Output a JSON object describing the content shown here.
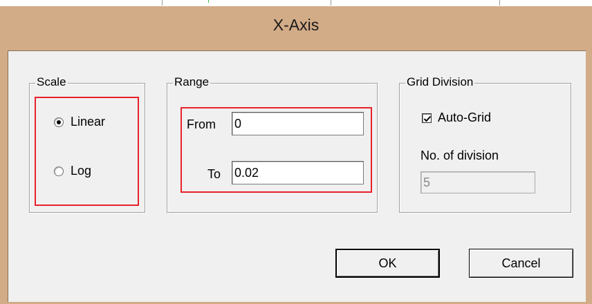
{
  "dialog": {
    "title": "X-Axis"
  },
  "scale": {
    "label": "Scale",
    "options": [
      {
        "label": "Linear",
        "selected": true
      },
      {
        "label": "Log",
        "selected": false
      }
    ]
  },
  "range": {
    "label": "Range",
    "from_label": "From",
    "from_value": "0",
    "to_label": "To",
    "to_value": "0.02"
  },
  "grid": {
    "label": "Grid Division",
    "auto_grid_label": "Auto-Grid",
    "auto_grid_checked": true,
    "division_label": "No. of division",
    "division_value": "5"
  },
  "buttons": {
    "ok": "OK",
    "cancel": "Cancel"
  },
  "colors": {
    "title_bar": "#d2ab87",
    "highlight": "#e8202a",
    "client": "#f0f0f0"
  }
}
